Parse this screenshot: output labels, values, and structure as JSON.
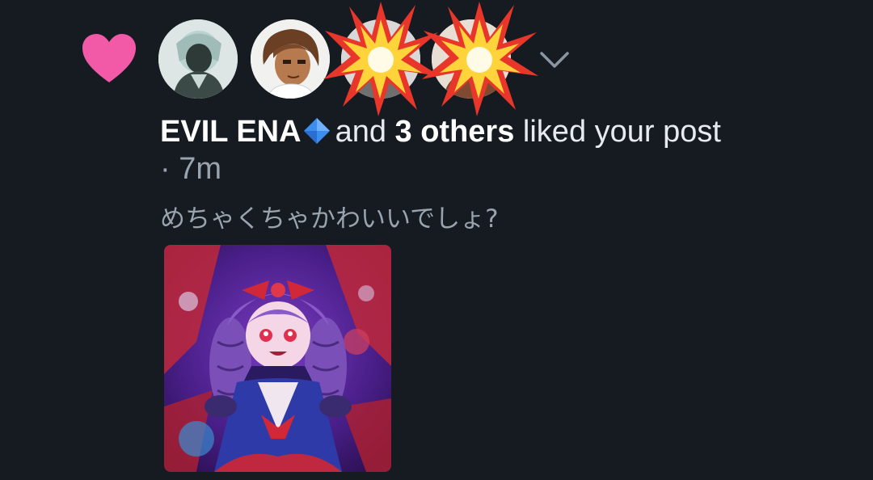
{
  "notification": {
    "liker_name": "EVIL ENA",
    "connector": "and",
    "others_label": "3 others",
    "action_text": "liked your post",
    "time_separator": "·",
    "time_ago": "7m",
    "post_text": "めちゃくちゃかわいいでしょ?",
    "icons": {
      "notification_type": "heart-icon",
      "name_badge": "blue-diamond-icon",
      "expand": "chevron-down-icon"
    },
    "colors": {
      "background": "#161b22",
      "heart": "#f25aa8",
      "primary_text": "#ffffff",
      "secondary_text": "#9aa4ae"
    }
  }
}
